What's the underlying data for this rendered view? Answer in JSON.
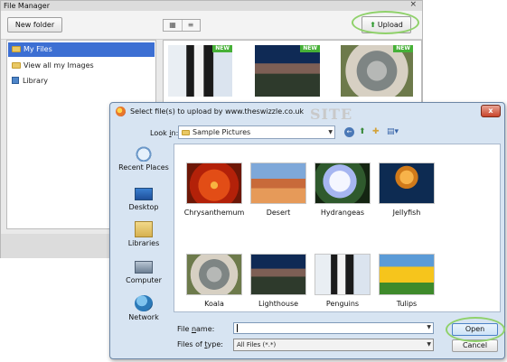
{
  "file_manager": {
    "title": "File Manager",
    "close_glyph": "×",
    "new_folder_label": "New folder",
    "view_grid_glyph": "▦",
    "view_list_glyph": "≡",
    "upload_label": "Upload",
    "upload_icon": "up-arrow-icon",
    "sidebar": {
      "items": [
        {
          "label": "My Files",
          "selected": true,
          "icon": "folder-open-icon"
        },
        {
          "label": "View all my Images",
          "selected": false,
          "icon": "folder-icon"
        },
        {
          "label": "Library",
          "selected": false,
          "icon": "library-icon"
        }
      ]
    },
    "thumbnails": [
      {
        "name": "Penguins",
        "badge": "NEW"
      },
      {
        "name": "Lighthouse",
        "badge": "NEW"
      },
      {
        "name": "Koala",
        "badge": "NEW"
      }
    ]
  },
  "dialog": {
    "title": "Select file(s) to upload by www.theswizzle.co.uk",
    "close_glyph": "x",
    "watermark": "SITE",
    "look_in_label_pre": "Look ",
    "look_in_label_u": "i",
    "look_in_label_post": "n:",
    "look_in_value": "Sample Pictures",
    "nav": {
      "back": "←",
      "up": "⬆",
      "new_folder": "✚",
      "views": "▤▾"
    },
    "places": [
      {
        "label": "Recent Places",
        "icon": "recent-places-icon"
      },
      {
        "label": "Desktop",
        "icon": "desktop-icon"
      },
      {
        "label": "Libraries",
        "icon": "libraries-icon"
      },
      {
        "label": "Computer",
        "icon": "computer-icon"
      },
      {
        "label": "Network",
        "icon": "network-icon"
      }
    ],
    "files": [
      {
        "name": "Chrysanthemum"
      },
      {
        "name": "Desert"
      },
      {
        "name": "Hydrangeas"
      },
      {
        "name": "Jellyfish"
      },
      {
        "name": "Koala"
      },
      {
        "name": "Lighthouse"
      },
      {
        "name": "Penguins"
      },
      {
        "name": "Tulips"
      }
    ],
    "file_name_label_pre": "File ",
    "file_name_label_u": "n",
    "file_name_label_post": "ame:",
    "file_name_value": "",
    "files_of_type_label_pre": "Files of ",
    "files_of_type_label_u": "t",
    "files_of_type_label_post": "ype:",
    "files_of_type_value": "All Files (*.*)",
    "open_label": "Open",
    "cancel_label": "Cancel",
    "dropdown_glyph": "▼"
  },
  "colors": {
    "highlight": "#8fd16a",
    "selection": "#3c6fd3",
    "badge": "#46b037"
  }
}
